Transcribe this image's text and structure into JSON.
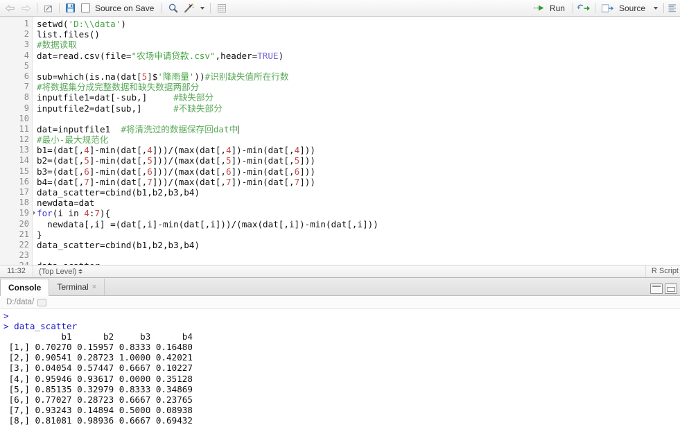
{
  "editor_toolbar": {
    "back_icon": "back-arrow-icon",
    "forward_icon": "forward-arrow-icon",
    "show_doc_outline_icon": "open-in-window-icon",
    "save_icon": "save-disk-icon",
    "source_on_save_label": "Source on Save",
    "find_icon": "magnifier-icon",
    "code_tools_icon": "magic-wand-icon",
    "code_tools_dropdown_icon": "chevron-down-icon",
    "compile_report_icon": "grid-report-icon",
    "run_icon": "run-arrow-icon",
    "run_label": "Run",
    "rerun_icon": "rerun-loop-icon",
    "source_icon": "source-arrow-icon",
    "source_label": "Source",
    "source_dropdown_icon": "chevron-down-icon",
    "outline_icon": "document-outline-icon"
  },
  "editor": {
    "lines": [
      {
        "n": "1",
        "fold": false,
        "tokens": [
          {
            "t": "setwd(",
            "c": ""
          },
          {
            "t": "'D:\\\\data'",
            "c": "tk-str"
          },
          {
            "t": ")",
            "c": ""
          }
        ]
      },
      {
        "n": "2",
        "fold": false,
        "tokens": [
          {
            "t": "list.files()",
            "c": ""
          }
        ]
      },
      {
        "n": "3",
        "fold": false,
        "tokens": [
          {
            "t": "#数据读取",
            "c": "tk-com"
          }
        ]
      },
      {
        "n": "4",
        "fold": false,
        "tokens": [
          {
            "t": "dat=read.csv(file=",
            "c": ""
          },
          {
            "t": "\"农场申请贷款.csv\"",
            "c": "tk-str"
          },
          {
            "t": ",header=",
            "c": ""
          },
          {
            "t": "TRUE",
            "c": "tk-const"
          },
          {
            "t": ")",
            "c": ""
          }
        ]
      },
      {
        "n": "5",
        "fold": false,
        "tokens": [
          {
            "t": "",
            "c": ""
          }
        ]
      },
      {
        "n": "6",
        "fold": false,
        "tokens": [
          {
            "t": "sub=which(is.na(dat[",
            "c": ""
          },
          {
            "t": "5",
            "c": "tk-num"
          },
          {
            "t": "]$",
            "c": ""
          },
          {
            "t": "'降雨量'",
            "c": "tk-str"
          },
          {
            "t": "))",
            "c": ""
          },
          {
            "t": "#识别缺失值所在行数",
            "c": "tk-com"
          }
        ]
      },
      {
        "n": "7",
        "fold": false,
        "tokens": [
          {
            "t": "#将数据集分成完整数据和缺失数据两部分",
            "c": "tk-com"
          }
        ]
      },
      {
        "n": "8",
        "fold": false,
        "tokens": [
          {
            "t": "inputfile1=dat[-sub,]     ",
            "c": ""
          },
          {
            "t": "#缺失部分",
            "c": "tk-com"
          }
        ]
      },
      {
        "n": "9",
        "fold": false,
        "tokens": [
          {
            "t": "inputfile2=dat[sub,]      ",
            "c": ""
          },
          {
            "t": "#不缺失部分",
            "c": "tk-com"
          }
        ]
      },
      {
        "n": "10",
        "fold": false,
        "tokens": [
          {
            "t": "",
            "c": ""
          }
        ]
      },
      {
        "n": "11",
        "fold": false,
        "tokens": [
          {
            "t": "dat=inputfile1  ",
            "c": ""
          },
          {
            "t": "#将清洗过的数据保存回dat中",
            "c": "tk-com"
          },
          {
            "t": "|",
            "c": "caret-mark"
          }
        ]
      },
      {
        "n": "12",
        "fold": false,
        "tokens": [
          {
            "t": "#最小-最大规范化",
            "c": "tk-com"
          }
        ]
      },
      {
        "n": "13",
        "fold": false,
        "tokens": [
          {
            "t": "b1=(dat[,",
            "c": ""
          },
          {
            "t": "4",
            "c": "tk-num"
          },
          {
            "t": "]-min(dat[,",
            "c": ""
          },
          {
            "t": "4",
            "c": "tk-num"
          },
          {
            "t": "]))/(max(dat[,",
            "c": ""
          },
          {
            "t": "4",
            "c": "tk-num"
          },
          {
            "t": "])-min(dat[,",
            "c": ""
          },
          {
            "t": "4",
            "c": "tk-num"
          },
          {
            "t": "]))",
            "c": ""
          }
        ]
      },
      {
        "n": "14",
        "fold": false,
        "tokens": [
          {
            "t": "b2=(dat[,",
            "c": ""
          },
          {
            "t": "5",
            "c": "tk-num"
          },
          {
            "t": "]-min(dat[,",
            "c": ""
          },
          {
            "t": "5",
            "c": "tk-num"
          },
          {
            "t": "]))/(max(dat[,",
            "c": ""
          },
          {
            "t": "5",
            "c": "tk-num"
          },
          {
            "t": "])-min(dat[,",
            "c": ""
          },
          {
            "t": "5",
            "c": "tk-num"
          },
          {
            "t": "]))",
            "c": ""
          }
        ]
      },
      {
        "n": "15",
        "fold": false,
        "tokens": [
          {
            "t": "b3=(dat[,",
            "c": ""
          },
          {
            "t": "6",
            "c": "tk-num"
          },
          {
            "t": "]-min(dat[,",
            "c": ""
          },
          {
            "t": "6",
            "c": "tk-num"
          },
          {
            "t": "]))/(max(dat[,",
            "c": ""
          },
          {
            "t": "6",
            "c": "tk-num"
          },
          {
            "t": "])-min(dat[,",
            "c": ""
          },
          {
            "t": "6",
            "c": "tk-num"
          },
          {
            "t": "]))",
            "c": ""
          }
        ]
      },
      {
        "n": "16",
        "fold": false,
        "tokens": [
          {
            "t": "b4=(dat[,",
            "c": ""
          },
          {
            "t": "7",
            "c": "tk-num"
          },
          {
            "t": "]-min(dat[,",
            "c": ""
          },
          {
            "t": "7",
            "c": "tk-num"
          },
          {
            "t": "]))/(max(dat[,",
            "c": ""
          },
          {
            "t": "7",
            "c": "tk-num"
          },
          {
            "t": "])-min(dat[,",
            "c": ""
          },
          {
            "t": "7",
            "c": "tk-num"
          },
          {
            "t": "]))",
            "c": ""
          }
        ]
      },
      {
        "n": "17",
        "fold": false,
        "tokens": [
          {
            "t": "data_scatter=cbind(b1,b2,b3,b4)",
            "c": ""
          }
        ]
      },
      {
        "n": "18",
        "fold": false,
        "tokens": [
          {
            "t": "newdata=dat",
            "c": ""
          }
        ]
      },
      {
        "n": "19",
        "fold": true,
        "tokens": [
          {
            "t": "for",
            "c": "tk-kw"
          },
          {
            "t": "(i in ",
            "c": ""
          },
          {
            "t": "4",
            "c": "tk-num"
          },
          {
            "t": ":",
            "c": ""
          },
          {
            "t": "7",
            "c": "tk-num"
          },
          {
            "t": "){",
            "c": ""
          }
        ]
      },
      {
        "n": "20",
        "fold": false,
        "tokens": [
          {
            "t": "  newdata[,i] =(dat[,i]-min(dat[,i]))/(max(dat[,i])-min(dat[,i]))",
            "c": ""
          }
        ]
      },
      {
        "n": "21",
        "fold": false,
        "tokens": [
          {
            "t": "}",
            "c": ""
          }
        ]
      },
      {
        "n": "22",
        "fold": false,
        "tokens": [
          {
            "t": "data_scatter=cbind(b1,b2,b3,b4)",
            "c": ""
          }
        ]
      },
      {
        "n": "23",
        "fold": false,
        "tokens": [
          {
            "t": "",
            "c": ""
          }
        ]
      },
      {
        "n": "24",
        "fold": false,
        "tokens": [
          {
            "t": "data_scatter",
            "c": ""
          }
        ]
      }
    ]
  },
  "editor_status": {
    "cursor_position": "11:32",
    "scope": "(Top Level)",
    "file_type": "R Script"
  },
  "console_panel": {
    "tabs": [
      {
        "label": "Console",
        "active": true,
        "closable": false
      },
      {
        "label": "Terminal",
        "active": false,
        "closable": true
      }
    ],
    "close_glyph": "×",
    "minimize_icon": "minimize-pane-icon",
    "maximize_icon": "maximize-pane-icon",
    "working_directory": "D:/data/",
    "shrink_icon": "open-in-window-icon",
    "output": [
      {
        "type": "prompt",
        "text": ">"
      },
      {
        "type": "command",
        "text": "> data_scatter"
      },
      {
        "type": "out",
        "text": "           b1      b2     b3      b4"
      },
      {
        "type": "out",
        "text": " [1,] 0.70270 0.15957 0.8333 0.16480"
      },
      {
        "type": "out",
        "text": " [2,] 0.90541 0.28723 1.0000 0.42021"
      },
      {
        "type": "out",
        "text": " [3,] 0.04054 0.57447 0.6667 0.10227"
      },
      {
        "type": "out",
        "text": " [4,] 0.95946 0.93617 0.0000 0.35128"
      },
      {
        "type": "out",
        "text": " [5,] 0.85135 0.32979 0.8333 0.34869"
      },
      {
        "type": "out",
        "text": " [6,] 0.77027 0.28723 0.6667 0.23765"
      },
      {
        "type": "out",
        "text": " [7,] 0.93243 0.14894 0.5000 0.08938"
      },
      {
        "type": "out",
        "text": " [8,] 0.81081 0.98936 0.6667 0.69432"
      }
    ]
  },
  "colors": {
    "string": "#47a447",
    "comment": "#5aa85a",
    "number": "#c24a4a",
    "keyword": "#3a3ad0",
    "constant": "#7a63d6",
    "console_prompt": "#1b1bc4",
    "run_green": "#2e9c2e",
    "save_blue": "#3e7fc1"
  }
}
